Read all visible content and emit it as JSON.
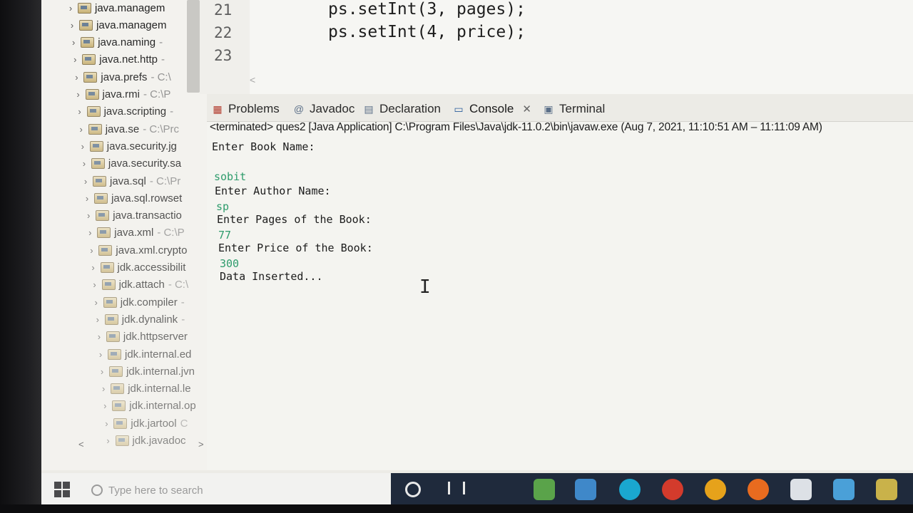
{
  "explorer": {
    "items": [
      {
        "label": "java.managem",
        "path": ""
      },
      {
        "label": "java.managem",
        "path": ""
      },
      {
        "label": "java.naming",
        "path": " -"
      },
      {
        "label": "java.net.http",
        "path": " -"
      },
      {
        "label": "java.prefs",
        "path": " - C:\\"
      },
      {
        "label": "java.rmi",
        "path": " - C:\\P"
      },
      {
        "label": "java.scripting",
        "path": " -"
      },
      {
        "label": "java.se",
        "path": " - C:\\Prc"
      },
      {
        "label": "java.security.jg",
        "path": ""
      },
      {
        "label": "java.security.sa",
        "path": ""
      },
      {
        "label": "java.sql",
        "path": " - C:\\Pr"
      },
      {
        "label": "java.sql.rowset",
        "path": ""
      },
      {
        "label": "java.transactio",
        "path": ""
      },
      {
        "label": "java.xml",
        "path": " - C:\\P"
      },
      {
        "label": "java.xml.crypto",
        "path": ""
      },
      {
        "label": "jdk.accessibilit",
        "path": ""
      },
      {
        "label": "jdk.attach",
        "path": " - C:\\"
      },
      {
        "label": "jdk.compiler",
        "path": " -"
      },
      {
        "label": "jdk.dynalink",
        "path": " -"
      },
      {
        "label": "jdk.httpserver",
        "path": ""
      },
      {
        "label": "jdk.internal.ed",
        "path": ""
      },
      {
        "label": "jdk.internal.jvn",
        "path": ""
      },
      {
        "label": "jdk.internal.le",
        "path": ""
      },
      {
        "label": "jdk.internal.op",
        "path": ""
      },
      {
        "label": "jdk.jartool",
        "path": " C"
      },
      {
        "label": "jdk.javadoc",
        "path": ""
      }
    ],
    "scroll_left": "<",
    "scroll_right": ">",
    "scroll_down": "˅"
  },
  "editor": {
    "lines": [
      {
        "num": "21",
        "code": "ps.setInt(3, pages);"
      },
      {
        "num": "22",
        "code": "ps.setInt(4, price);"
      },
      {
        "num": "23",
        "code": ""
      }
    ],
    "scroll_left": "<"
  },
  "views": {
    "tabs": [
      {
        "label": "Problems",
        "icon": "problems-icon",
        "active": false
      },
      {
        "label": "Javadoc",
        "icon": "javadoc-icon",
        "active": false
      },
      {
        "label": "Declaration",
        "icon": "declaration-icon",
        "active": false
      },
      {
        "label": "Console",
        "icon": "console-icon",
        "active": true
      },
      {
        "label": "Terminal",
        "icon": "terminal-icon",
        "active": false
      }
    ],
    "close_glyph": "✕",
    "status": "<terminated> ques2 [Java Application] C:\\Program Files\\Java\\jdk-11.0.2\\bin\\javaw.exe  (Aug 7, 2021, 11:10:51 AM – 11:11:09 AM)"
  },
  "console": {
    "lines": [
      {
        "text": "Enter Book Name:",
        "kind": "prompt"
      },
      {
        "text": "sobit",
        "kind": "input"
      },
      {
        "text": "Enter Author Name:",
        "kind": "prompt"
      },
      {
        "text": "sp",
        "kind": "input"
      },
      {
        "text": "Enter Pages of the Book:",
        "kind": "prompt"
      },
      {
        "text": "77",
        "kind": "input"
      },
      {
        "text": "Enter Price of the Book:",
        "kind": "prompt"
      },
      {
        "text": "300",
        "kind": "input"
      },
      {
        "text": "Data Inserted...",
        "kind": "prompt"
      }
    ]
  },
  "taskbar": {
    "search_placeholder": "Type here to search",
    "colors": {
      "dark": "#1f2a3c",
      "icons": [
        "#5aa34a",
        "#3f88c9",
        "#1aa7cf",
        "#d33b2c",
        "#e6a21b",
        "#e86b1f",
        "#dde1e6",
        "#4aa0d8",
        "#c9b24a"
      ]
    }
  }
}
